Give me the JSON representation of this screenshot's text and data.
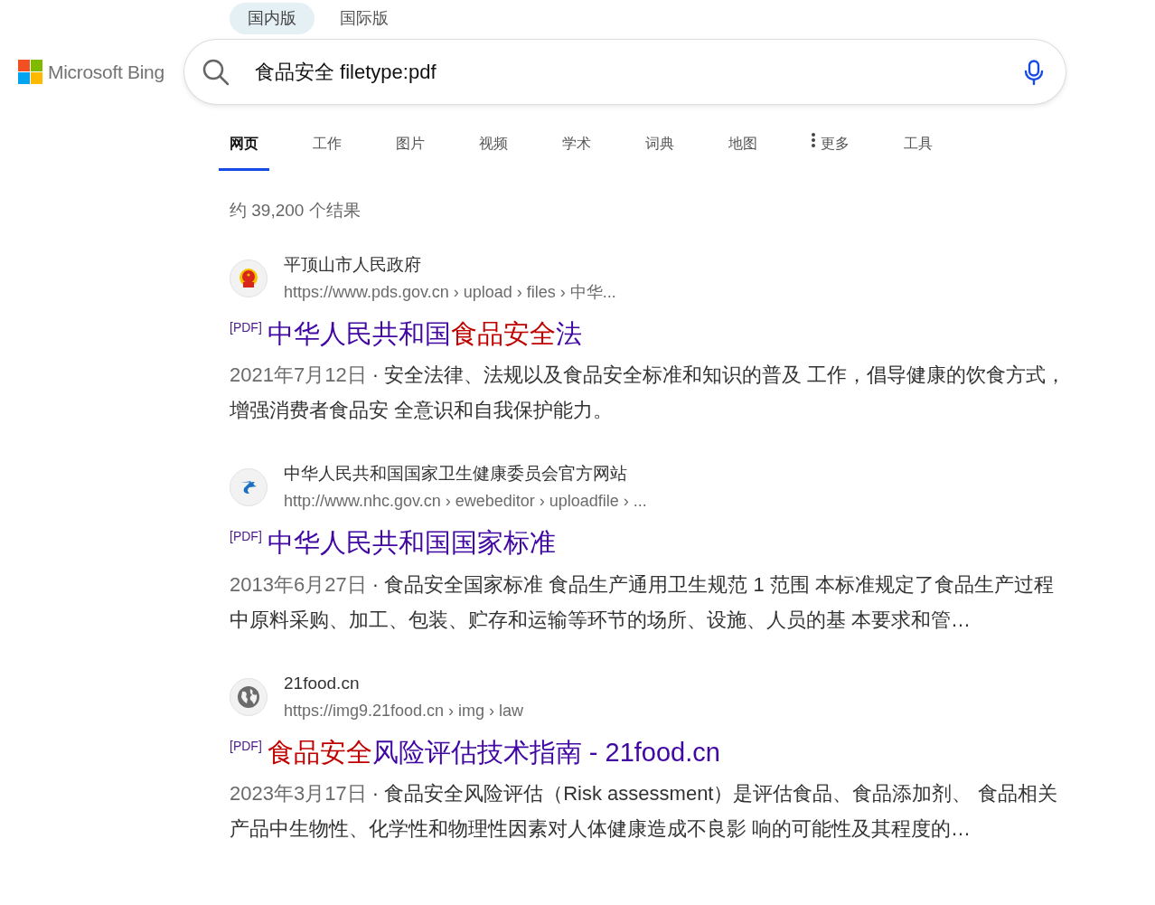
{
  "editions": [
    {
      "label": "国内版",
      "selected": true
    },
    {
      "label": "国际版",
      "selected": false
    }
  ],
  "logo": {
    "text": "Microsoft Bing"
  },
  "search": {
    "value": "食品安全 filetype:pdf"
  },
  "tabs": [
    {
      "label": "网页",
      "selected": true,
      "kind": "plain"
    },
    {
      "label": "工作",
      "selected": false,
      "kind": "plain"
    },
    {
      "label": "图片",
      "selected": false,
      "kind": "plain"
    },
    {
      "label": "视频",
      "selected": false,
      "kind": "plain"
    },
    {
      "label": "学术",
      "selected": false,
      "kind": "plain"
    },
    {
      "label": "词典",
      "selected": false,
      "kind": "plain"
    },
    {
      "label": "地图",
      "selected": false,
      "kind": "plain"
    },
    {
      "label": "更多",
      "selected": false,
      "kind": "more"
    },
    {
      "label": "工具",
      "selected": false,
      "kind": "plain"
    }
  ],
  "result_count": "约 39,200 个结果",
  "results": [
    {
      "site": "平顶山市人民政府",
      "kind": "emblem",
      "url": "https://www.pds.gov.cn › upload › files › 中华...",
      "tag": "[PDF]",
      "title": [
        {
          "text": "中华人民共和国",
          "highlight": false
        },
        {
          "text": "食品安全",
          "highlight": true
        },
        {
          "text": "法",
          "highlight": false
        }
      ],
      "date": "2021年7月12日",
      "separator": "·",
      "snippet": "安全法律、法规以及食品安全标准和知识的普及 工作，倡导健康的饮食方式，增强消费者食品安 全意识和自我保护能力。"
    },
    {
      "site": "中华人民共和国国家卫生健康委员会官方网站",
      "kind": "bird",
      "url": "http://www.nhc.gov.cn › ewebeditor › uploadfile › ...",
      "tag": "[PDF]",
      "title": [
        {
          "text": "中华人民共和国国家标准",
          "highlight": false
        }
      ],
      "date": "2013年6月27日",
      "separator": "·",
      "snippet": "食品安全国家标准 食品生产通用卫生规范 1 范围 本标准规定了食品生产过程中原料采购、加工、包装、贮存和运输等环节的场所、设施、人员的基 本要求和管…"
    },
    {
      "site": "21food.cn",
      "kind": "globe",
      "url": "https://img9.21food.cn › img › law",
      "tag": "[PDF]",
      "title": [
        {
          "text": "食品安全",
          "highlight": true
        },
        {
          "text": "风险评估技术指南 - 21food.cn",
          "highlight": false
        }
      ],
      "date": "2023年3月17日",
      "separator": "·",
      "snippet": "食品安全风险评估（Risk assessment）是评估食品、食品添加剂、 食品相关产品中生物性、化学性和物理性因素对人体健康造成不良影 响的可能性及其程度的…"
    }
  ]
}
